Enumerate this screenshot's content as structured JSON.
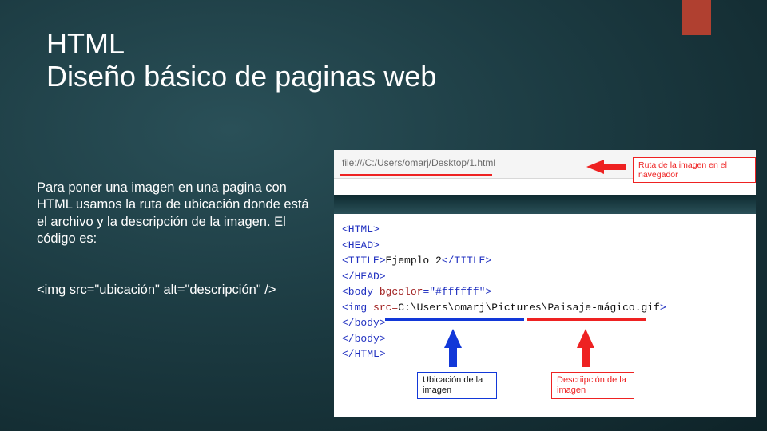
{
  "title": {
    "line1": "HTML",
    "line2": "Diseño básico de paginas web"
  },
  "left": {
    "para": "Para poner una imagen en una pagina con HTML usamos la ruta de ubicación  donde está el archivo y la descripción de la imagen. El código es:",
    "code_example": "<img src=\"ubicación\" alt=\"descripción\" />"
  },
  "right": {
    "url_text": "file:///C:/Users/omarj/Desktop/1.html",
    "url_caption": "Ruta de la imagen en el navegador",
    "code_lines": [
      {
        "raw": "<HTML>"
      },
      {
        "raw": "<HEAD>"
      },
      {
        "raw_html": "<span class='tag'>&lt;TITLE&gt;</span>Ejemplo 2<span class='tag'>&lt;/TITLE&gt;</span>"
      },
      {
        "raw": "</HEAD>"
      },
      {
        "raw_html": "<span class='tag'>&lt;body</span> <span class='mar'>bgcolor</span><span class='tag'>=\"#ffffff\"&gt;</span>"
      },
      {
        "raw_html": "<span class='tag'>&lt;img</span> <span class='mar'>src=</span>C:\\Users\\omarj\\Pictures\\Paisaje-mágico.gif<span class='tag'>&gt;</span>"
      },
      {
        "raw": "</body>"
      },
      {
        "raw": "</body>"
      },
      {
        "raw": "</HTML>"
      }
    ],
    "caption_blue": "Ubicación de la imagen",
    "caption_red": "Descriipción de la imagen"
  }
}
